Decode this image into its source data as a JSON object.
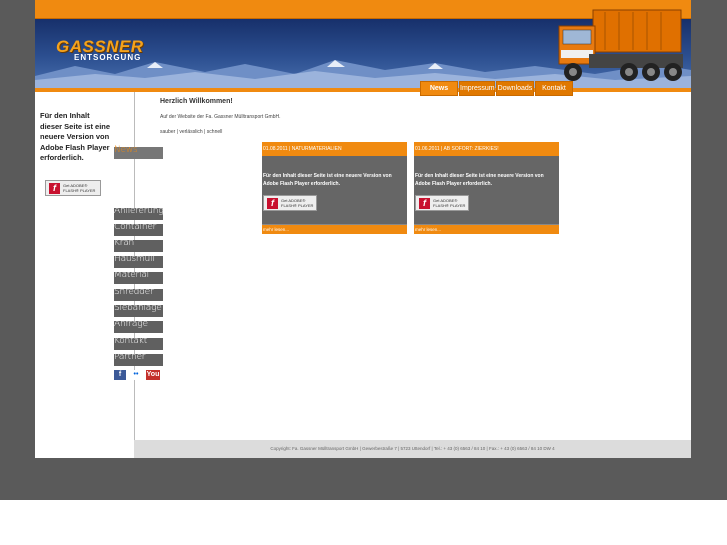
{
  "brand": {
    "name": "GASSNER",
    "sub": "ENTSORGUNG"
  },
  "top_nav": [
    {
      "label": "News"
    },
    {
      "label": "Impressum"
    },
    {
      "label": "Downloads"
    },
    {
      "label": "Kontakt"
    }
  ],
  "flash_notice": "Für den Inhalt dieser Seite ist eine neuere Version von Adobe Flash Player erforderlich.",
  "flash_badge": {
    "line1": "Get ADOBE®",
    "line2": "FLASH® PLAYER"
  },
  "side_nav": [
    {
      "label": "News"
    },
    {
      "label": "Anlieferung"
    },
    {
      "label": "Container"
    },
    {
      "label": "Kran"
    },
    {
      "label": "Hausmüll"
    },
    {
      "label": "Material"
    },
    {
      "label": "Shredder"
    },
    {
      "label": "Siebanlage"
    },
    {
      "label": "Anfrage"
    },
    {
      "label": "Kontakt"
    },
    {
      "label": "Partner"
    }
  ],
  "social": [
    {
      "icon": "facebook-icon",
      "label": "f",
      "color": "#3b5998"
    },
    {
      "icon": "flickr-icon",
      "label": "••",
      "color": "#ffffff"
    },
    {
      "icon": "youtube-icon",
      "label": "You",
      "color": "#c4302b"
    }
  ],
  "welcome": {
    "title": "Herzlich Willkommen!",
    "text": "Auf der Website der Fa. Gassner Mülltransport GmbH.",
    "tagline": "sauber | verlässlich | schnell"
  },
  "news": [
    {
      "header": "01.08.2011 | NATURMATERIALIEN",
      "message": "Für den Inhalt dieser Seite ist eine neuere Version von Adobe Flash Player erforderlich.",
      "more": "mehr lesen..."
    },
    {
      "header": "01.06.2011 | AB SOFORT: ZIERKIES!",
      "message": "Für den Inhalt dieser Seite ist eine neuere Version von Adobe Flash Player erforderlich.",
      "more": "mehr lesen..."
    }
  ],
  "footer": "Copyright: Fa. Gassner Mülltransport GmbH | Gewerbestraße 7 | 5723 Uttendorf | Tel.: + 43 (0) 6563 / 84 10 | Fax.: + 43 (0) 6563 / 84 10 DW 4",
  "colors": {
    "accent": "#f08a10",
    "header": "#1f3a78",
    "nav": "#606060"
  }
}
